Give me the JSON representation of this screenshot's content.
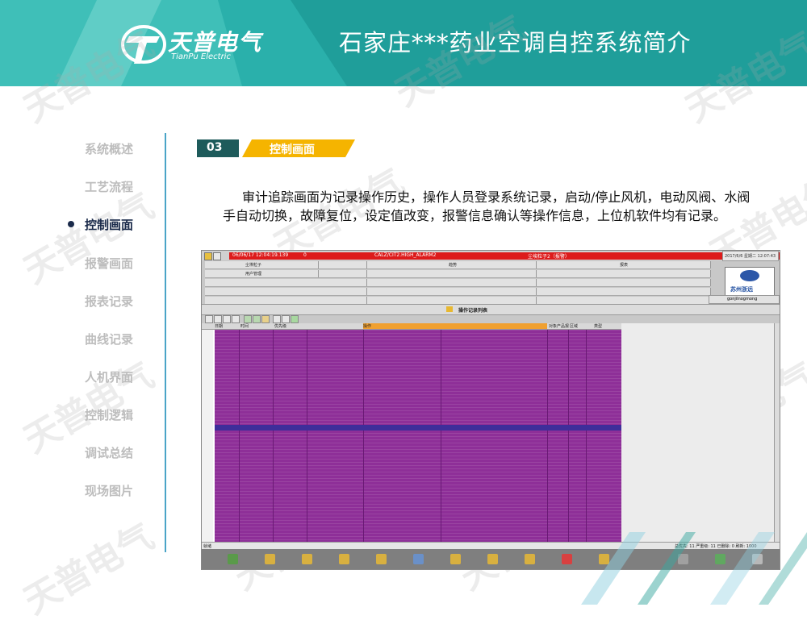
{
  "header": {
    "brand": "天普电气",
    "brand_sub": "TianPu Electric",
    "title": "石家庄***药业空调自控系统简介"
  },
  "watermark": "天普电气",
  "nav": {
    "items": [
      {
        "label": "系统概述",
        "active": false
      },
      {
        "label": "工艺流程",
        "active": false
      },
      {
        "label": "控制画面",
        "active": true
      },
      {
        "label": "报警画面",
        "active": false
      },
      {
        "label": "报表记录",
        "active": false
      },
      {
        "label": "曲线记录",
        "active": false
      },
      {
        "label": "人机界面",
        "active": false
      },
      {
        "label": "控制逻辑",
        "active": false
      },
      {
        "label": "调试总结",
        "active": false
      },
      {
        "label": "现场图片",
        "active": false
      }
    ]
  },
  "section": {
    "number": "03",
    "title": "控制画面"
  },
  "description": "审计追踪画面为记录操作历史，操作人员登录系统记录，启动/停止风机，电动风阀、水阀手自动切换，故障复位，设定值改变，报警信息确认等操作信息，上位机软件均有记录。",
  "screenshot": {
    "alarm_time": "06/06/17 12:04:19.139",
    "alarm_zero": "0",
    "alarm_tag": "CALZ/CIT2.HIGH_ALARM2",
    "alarm_msg": "尘埃粒子2（报警）",
    "clock": "2017/6/6 星期二 12:07:43",
    "left_buttons": [
      "尘埃粒子",
      "用户管理"
    ],
    "mid_label": "趋势",
    "right_label": "报表",
    "company": "苏州浙远",
    "user_field": "gonjilnogmong",
    "oplist_title": "操作记录列表",
    "columns": [
      "日期",
      "时间",
      "优先级",
      "操作",
      "对象产品报",
      "区域",
      "类型"
    ],
    "status_left": "就绪",
    "status_right": "总优先: 11  严重级: 11  已删除: 0  刷新: 1000"
  },
  "colors": {
    "header_teal": "#1f9e9a",
    "accent_orange": "#f5b400",
    "section_dark": "#1e5b5b",
    "nav_active": "#1a2a4a",
    "log_purple": "#8e2f98",
    "alarm_red": "#dd1b1b"
  }
}
